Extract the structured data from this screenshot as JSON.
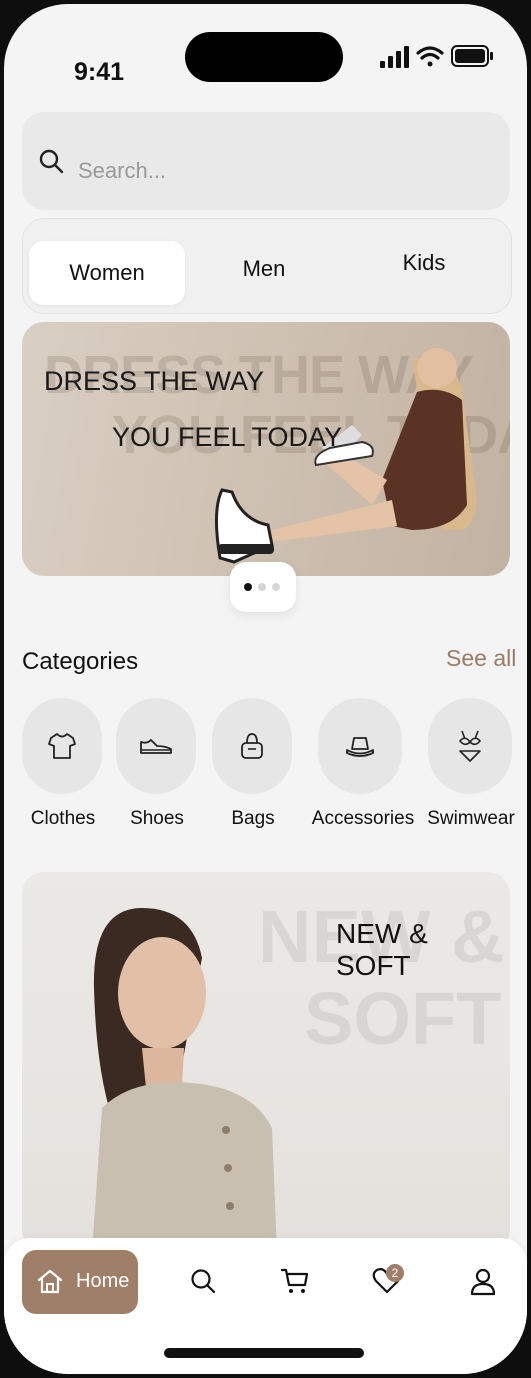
{
  "status_bar": {
    "time": "9:41"
  },
  "search": {
    "placeholder": "Search..."
  },
  "tabs": [
    {
      "label": "Women",
      "active": true
    },
    {
      "label": "Men",
      "active": false
    },
    {
      "label": "Kids",
      "active": false
    }
  ],
  "hero_banner": {
    "line1": "DRESS THE WAY",
    "line2": "YOU FEEL TODAY",
    "background_text_1": "DRESS THE WAY",
    "background_text_2": "YOU FEEL TODA",
    "carousel": {
      "total": 3,
      "active_index": 0
    }
  },
  "categories": {
    "title": "Categories",
    "see_all": "See all",
    "items": [
      {
        "label": "Clothes",
        "icon": "tshirt-icon"
      },
      {
        "label": "Shoes",
        "icon": "shoe-icon"
      },
      {
        "label": "Bags",
        "icon": "bag-icon"
      },
      {
        "label": "Accessories",
        "icon": "bucket-hat-icon"
      },
      {
        "label": "Swimwear",
        "icon": "bikini-icon"
      }
    ]
  },
  "promo_banner": {
    "headline": "NEW & SOFT",
    "background_text_1": "NEW &",
    "background_text_2": "SOFT"
  },
  "bottom_nav": {
    "home_label": "Home",
    "wishlist_badge": "2",
    "items": [
      "home-icon",
      "search-icon",
      "cart-icon",
      "heart-icon",
      "profile-icon"
    ]
  },
  "colors": {
    "accent": "#a07f69",
    "see_all": "#9a7b66",
    "background": "#f4f4f4"
  }
}
